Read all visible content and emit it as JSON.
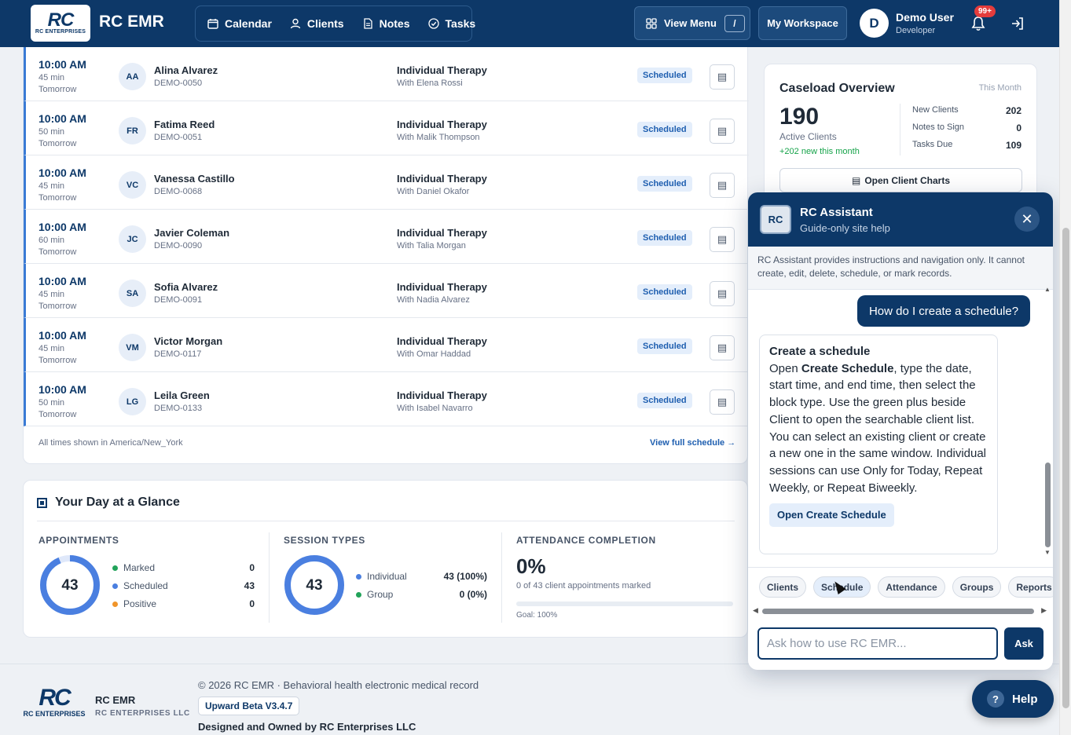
{
  "header": {
    "logo_text": "RC",
    "logo_subtext": "RC ENTERPRISES",
    "brand": "RC EMR",
    "nav": [
      {
        "label": "Calendar",
        "icon": "calendar-icon"
      },
      {
        "label": "Clients",
        "icon": "user-icon"
      },
      {
        "label": "Notes",
        "icon": "document-icon"
      },
      {
        "label": "Tasks",
        "icon": "check-circle-icon"
      }
    ],
    "view_menu_label": "View Menu",
    "view_menu_shortcut": "/",
    "workspace_label": "My Workspace",
    "user_initial": "D",
    "user_name": "Demo User",
    "user_role": "Developer",
    "notification_count": "99+"
  },
  "schedule": {
    "rows": [
      {
        "time": "10:00 AM",
        "duration": "45 min",
        "when": "Tomorrow",
        "initials": "AA",
        "name": "Alina Alvarez",
        "id": "DEMO-0050",
        "type": "Individual Therapy",
        "with": "With Elena Rossi",
        "status": "Scheduled"
      },
      {
        "time": "10:00 AM",
        "duration": "50 min",
        "when": "Tomorrow",
        "initials": "FR",
        "name": "Fatima Reed",
        "id": "DEMO-0051",
        "type": "Individual Therapy",
        "with": "With Malik Thompson",
        "status": "Scheduled"
      },
      {
        "time": "10:00 AM",
        "duration": "45 min",
        "when": "Tomorrow",
        "initials": "VC",
        "name": "Vanessa Castillo",
        "id": "DEMO-0068",
        "type": "Individual Therapy",
        "with": "With Daniel Okafor",
        "status": "Scheduled"
      },
      {
        "time": "10:00 AM",
        "duration": "60 min",
        "when": "Tomorrow",
        "initials": "JC",
        "name": "Javier Coleman",
        "id": "DEMO-0090",
        "type": "Individual Therapy",
        "with": "With Talia Morgan",
        "status": "Scheduled"
      },
      {
        "time": "10:00 AM",
        "duration": "45 min",
        "when": "Tomorrow",
        "initials": "SA",
        "name": "Sofia Alvarez",
        "id": "DEMO-0091",
        "type": "Individual Therapy",
        "with": "With Nadia Alvarez",
        "status": "Scheduled"
      },
      {
        "time": "10:00 AM",
        "duration": "45 min",
        "when": "Tomorrow",
        "initials": "VM",
        "name": "Victor Morgan",
        "id": "DEMO-0117",
        "type": "Individual Therapy",
        "with": "With Omar Haddad",
        "status": "Scheduled"
      },
      {
        "time": "10:00 AM",
        "duration": "50 min",
        "when": "Tomorrow",
        "initials": "LG",
        "name": "Leila Green",
        "id": "DEMO-0133",
        "type": "Individual Therapy",
        "with": "With Isabel Navarro",
        "status": "Scheduled"
      }
    ],
    "timezone_note": "All times shown in America/New_York",
    "full_schedule_link": "View full schedule →"
  },
  "glance": {
    "title": "Your Day at a Glance",
    "appointments": {
      "heading": "APPOINTMENTS",
      "total": "43",
      "items": [
        {
          "label": "Marked",
          "value": "0",
          "color": "#22a35a"
        },
        {
          "label": "Scheduled",
          "value": "43",
          "color": "#4a7fe0"
        },
        {
          "label": "Positive",
          "value": "0",
          "color": "#f0952a"
        }
      ]
    },
    "session_types": {
      "heading": "SESSION TYPES",
      "total": "43",
      "items": [
        {
          "label": "Individual",
          "value": "43 (100%)",
          "color": "#4a7fe0"
        },
        {
          "label": "Group",
          "value": "0 (0%)",
          "color": "#22a35a"
        }
      ]
    },
    "attendance": {
      "heading": "ATTENDANCE COMPLETION",
      "percent": "0%",
      "progress": 0,
      "subtitle": "0 of 43 client appointments marked",
      "goal": "Goal: 100%"
    }
  },
  "caseload": {
    "title": "Caseload Overview",
    "period": "This Month",
    "active_count": "190",
    "active_label": "Active Clients",
    "new_this_month": "+202 new this month",
    "stats": [
      {
        "label": "New Clients",
        "value": "202"
      },
      {
        "label": "Notes to Sign",
        "value": "0"
      },
      {
        "label": "Tasks Due",
        "value": "109"
      }
    ],
    "button_label": "Open Client Charts"
  },
  "assistant": {
    "logo": "RC",
    "title": "RC Assistant",
    "subtitle": "Guide-only site help",
    "notice": "RC Assistant provides instructions and navigation only. It cannot create, edit, delete, schedule, or mark records.",
    "user_message": "How do I create a schedule?",
    "reply_heading": "Create a schedule",
    "reply_pre": "Open ",
    "reply_bold": "Create Schedule",
    "reply_post": ", type the date, start time, and end time, then select the block type. Use the green plus beside Client to open the searchable client list. You can select an existing client or create a new one in the same window. Individual sessions can use Only for Today, Repeat Weekly, or Repeat Biweekly.",
    "reply_button": "Open Create Schedule",
    "chips": [
      "Clients",
      "Schedule",
      "Attendance",
      "Groups",
      "Reports"
    ],
    "input_placeholder": "Ask how to use RC EMR...",
    "ask_label": "Ask"
  },
  "footer": {
    "logo_text": "RC",
    "logo_subtext": "RC ENTERPRISES",
    "brand": "RC EMR",
    "company": "RC ENTERPRISES LLC",
    "copyright": "© 2026 RC EMR · Behavioral health electronic medical record",
    "version": "Upward Beta V3.4.7",
    "owned": "Designed and Owned by RC Enterprises LLC"
  },
  "help_label": "Help"
}
